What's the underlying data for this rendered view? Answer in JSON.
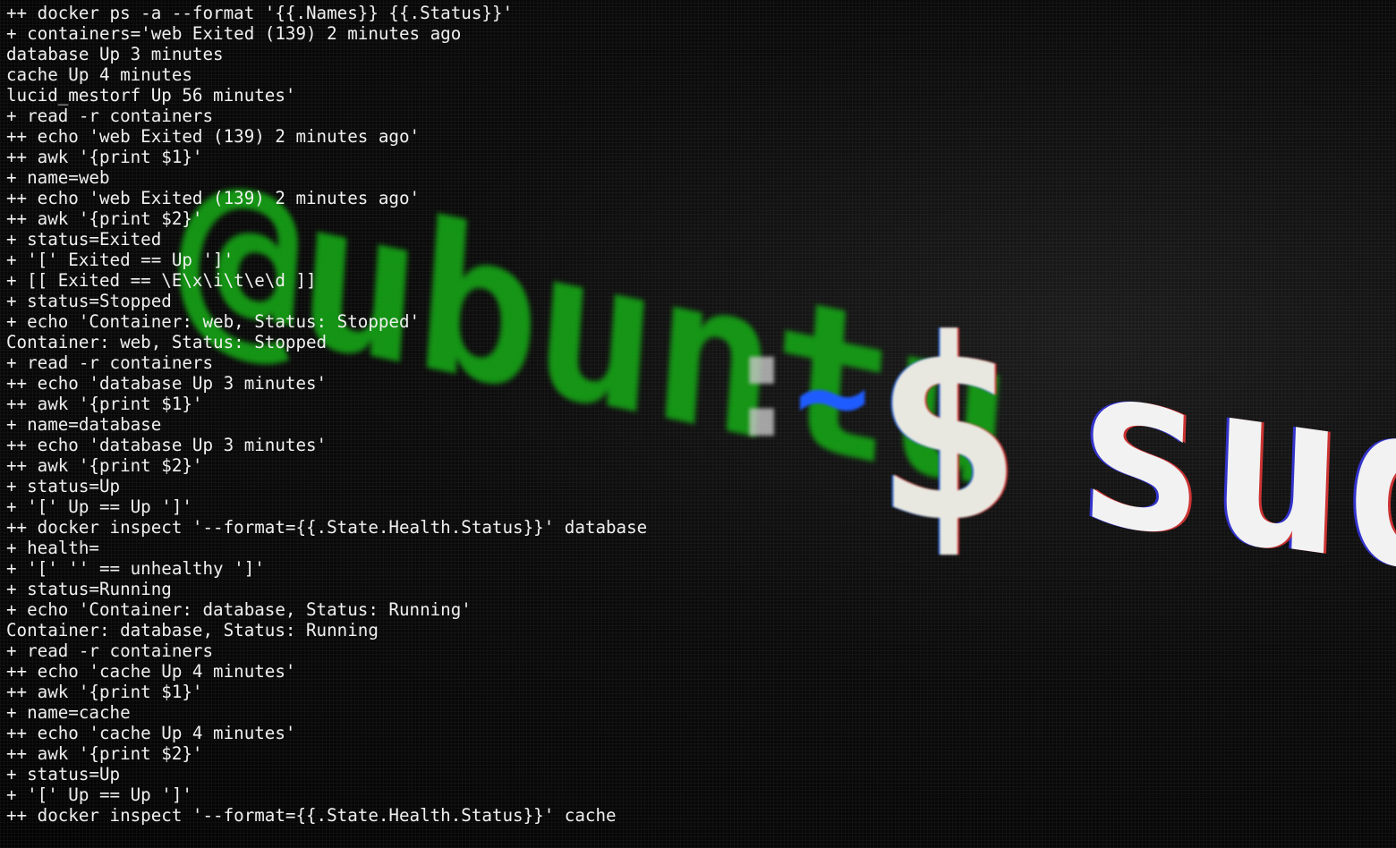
{
  "wallpaper": {
    "hostname": "@ubuntu",
    "colon": ":",
    "tilde": "~",
    "dollar": "$",
    "command": "sudo",
    "colors": {
      "hostname": "#16a316",
      "tilde": "#1f5cff",
      "dollar": "#e8e8e0",
      "command": "#f2f2f2"
    }
  },
  "terminal": {
    "text_color": "#f0f0f0",
    "background": "#050505",
    "lines": [
      "++ docker ps -a --format '{{.Names}} {{.Status}}'",
      "+ containers='web Exited (139) 2 minutes ago",
      "database Up 3 minutes",
      "cache Up 4 minutes",
      "lucid_mestorf Up 56 minutes'",
      "+ read -r containers",
      "++ echo 'web Exited (139) 2 minutes ago'",
      "++ awk '{print $1}'",
      "+ name=web",
      "++ echo 'web Exited (139) 2 minutes ago'",
      "++ awk '{print $2}'",
      "+ status=Exited",
      "+ '[' Exited == Up ']'",
      "+ [[ Exited == \\E\\x\\i\\t\\e\\d ]]",
      "+ status=Stopped",
      "+ echo 'Container: web, Status: Stopped'",
      "Container: web, Status: Stopped",
      "+ read -r containers",
      "++ echo 'database Up 3 minutes'",
      "++ awk '{print $1}'",
      "+ name=database",
      "++ echo 'database Up 3 minutes'",
      "++ awk '{print $2}'",
      "+ status=Up",
      "+ '[' Up == Up ']'",
      "++ docker inspect '--format={{.State.Health.Status}}' database",
      "+ health=",
      "+ '[' '' == unhealthy ']'",
      "+ status=Running",
      "+ echo 'Container: database, Status: Running'",
      "Container: database, Status: Running",
      "+ read -r containers",
      "++ echo 'cache Up 4 minutes'",
      "++ awk '{print $1}'",
      "+ name=cache",
      "++ echo 'cache Up 4 minutes'",
      "++ awk '{print $2}'",
      "+ status=Up",
      "+ '[' Up == Up ']'",
      "++ docker inspect '--format={{.State.Health.Status}}' cache"
    ]
  }
}
